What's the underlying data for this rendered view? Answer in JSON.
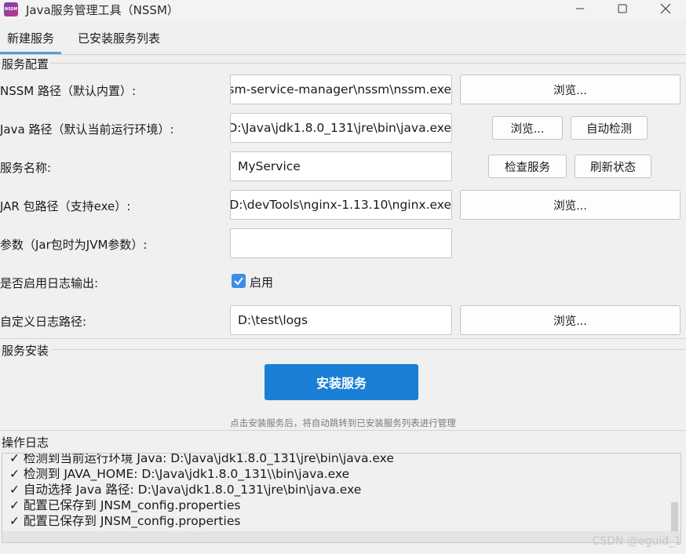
{
  "window": {
    "icon_text": "NSSM",
    "title": "Java服务管理工具（NSSM）",
    "controls": [
      "minimize",
      "maximize",
      "close"
    ]
  },
  "tabs": [
    {
      "label": "新建服务",
      "active": true
    },
    {
      "label": "已安装服务列表",
      "active": false
    }
  ],
  "config": {
    "section_title": "服务配置",
    "nssm_label": "NSSM 路径（默认内置）:",
    "nssm_value": "sm-service-manager\\nssm\\nssm.exe",
    "nssm_browse": "浏览...",
    "java_label": "Java 路径（默认当前运行环境）:",
    "java_value": "D:\\Java\\jdk1.8.0_131\\jre\\bin\\java.exe",
    "java_browse": "浏览...",
    "java_detect": "自动检测",
    "service_name_label": "服务名称:",
    "service_name_value": "MyService",
    "check_service": "检查服务",
    "refresh_status": "刷新状态",
    "jar_label": "JAR 包路径（支持exe）:",
    "jar_value": "D:\\devTools\\nginx-1.13.10\\nginx.exe",
    "jar_browse": "浏览...",
    "args_label": "参数（Jar包时为JVM参数）:",
    "args_value": "",
    "log_enable_label": "是否启用日志输出:",
    "log_enable_checked": true,
    "log_enable_text": "启用",
    "log_path_label": "自定义日志路径:",
    "log_path_value": "D:\\test\\logs",
    "log_path_browse": "浏览..."
  },
  "install": {
    "section_title": "服务安装",
    "button": "安装服务",
    "hint": "点击安装服务后，将自动跳转到已安装服务列表进行管理"
  },
  "log": {
    "section_title": "操作日志",
    "lines": [
      "✓ 检测到当前运行环境 Java: D:\\Java\\jdk1.8.0_131\\jre\\bin\\java.exe",
      "✓ 检测到 JAVA_HOME: D:\\Java\\jdk1.8.0_131\\\\bin\\java.exe",
      "✓ 自动选择 Java 路径: D:\\Java\\jdk1.8.0_131\\jre\\bin\\java.exe",
      "✓ 配置已保存到 JNSM_config.properties",
      "✓ 配置已保存到 JNSM_config.properties"
    ]
  },
  "watermark": "CSDN @eguid_1",
  "colors": {
    "accent": "#1a7fd4",
    "checkbox": "#3a8ee6",
    "tab_underline": "#5b9bd5",
    "background": "#f0f0f0"
  }
}
